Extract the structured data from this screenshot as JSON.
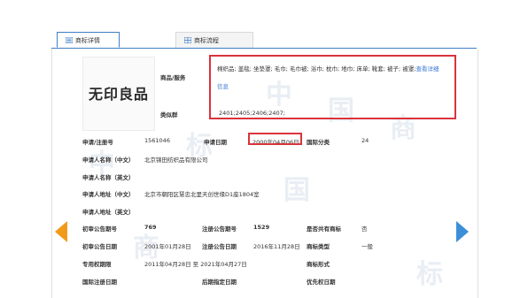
{
  "tabs": [
    {
      "label": "商标详情",
      "icon": "document-list-icon",
      "active": true
    },
    {
      "label": "商标流程",
      "icon": "table-grid-icon",
      "active": false
    }
  ],
  "logo_text": "无印良品",
  "goods_label": "商品/服务",
  "goods_value": "棉织品; 盖毯; 坐垫罩; 毛巾; 毛巾被; 浴巾; 枕巾; 地巾; 床单; 靴套; 被子; 被罩;",
  "goods_link": "查看详细",
  "goods_link2": "信息",
  "similar_label": "类似群",
  "similar_value": "2401;2405;2406;2407;",
  "fields": {
    "reg_no_label": "申请/注册号",
    "reg_no": "1561046",
    "apply_date_label": "申请日期",
    "apply_date": "2000年04月06日",
    "intl_class_label": "国际分类",
    "intl_class": "24",
    "applicant_cn_label": "申请人名称（中文）",
    "applicant_cn": "北京锦田纺织品有限公司",
    "applicant_en_label": "申请人名称（英文）",
    "address_cn_label": "申请人地址（中文）",
    "address_cn": "北京市朝阳区慧忠北里天创世缘D1座1804室",
    "address_en_label": "申请人地址（英文）",
    "prelim_no_label": "初审公告期号",
    "prelim_no": "769",
    "reg_pub_no_label": "注册公告期号",
    "reg_pub_no": "1529",
    "shared_label": "是否共有商标",
    "shared": "否",
    "prelim_date_label": "初审公告日期",
    "prelim_date": "2001年01月28日",
    "reg_pub_date_label": "注册公告日期",
    "reg_pub_date": "2016年11月28日",
    "type_label": "商标类型",
    "type": "一般",
    "exclusive_label": "专用权期限",
    "exclusive": "2011年04月28日 至 2021年04月27日",
    "form_label": "商标形式",
    "intl_reg_label": "国际注册日期",
    "later_label": "后期指定日期",
    "priority_label": "优先权日期"
  },
  "watermark_chars": [
    "中",
    "国",
    "商",
    "标",
    "中",
    "国",
    "商",
    "标"
  ],
  "colors": {
    "accent": "#3f7fc4",
    "highlight": "#d9343c",
    "prev_arrow": "#f29a1c",
    "next_arrow": "#3c8fd8"
  }
}
